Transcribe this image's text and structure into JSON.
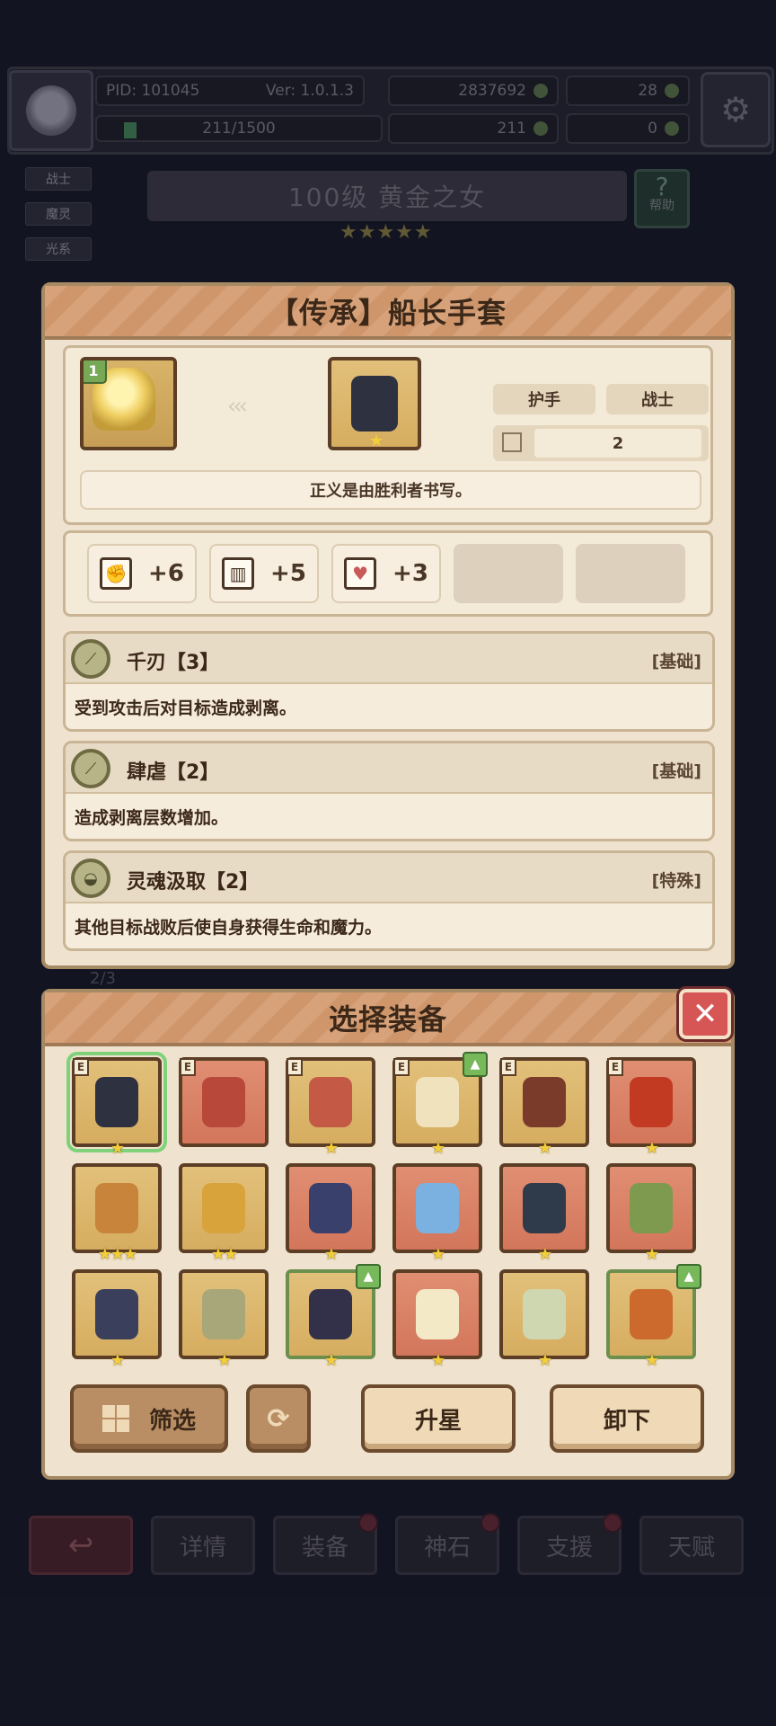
{
  "hud": {
    "pid": "PID: 101045",
    "version": "Ver: 1.0.1.3",
    "gold": "2837692",
    "gems": "28",
    "exp": "211/1500",
    "clover": "211",
    "keys": "0"
  },
  "hero": {
    "tags": [
      "战士",
      "魔灵",
      "光系"
    ],
    "title": "100级  黄金之女",
    "stars": "★★★★★",
    "help_label": "帮助"
  },
  "item_detail": {
    "title": "【传承】船长手套",
    "hero_level": "1",
    "slot": "护手",
    "class": "战士",
    "count": "2",
    "flavor": "正义是由胜利者书写。",
    "stats": [
      {
        "icon": "fist-icon",
        "value": "+6"
      },
      {
        "icon": "book-icon",
        "value": "+5"
      },
      {
        "icon": "heart-icon",
        "value": "+3"
      }
    ],
    "skills": [
      {
        "name": "千刃【3】",
        "type": "[基础]",
        "desc": "受到攻击后对目标造成剥离。"
      },
      {
        "name": "肆虐【2】",
        "type": "[基础]",
        "desc": "造成剥离层数增加。"
      },
      {
        "name": "灵魂汲取【2】",
        "type": "[特殊]",
        "desc": "其他目标战败后使自身获得生命和魔力。"
      }
    ]
  },
  "select_panel": {
    "title": "选择装备",
    "equip_badge": "E",
    "items": [
      {
        "color": "#2d3140",
        "bg": "gold",
        "equipped": true,
        "stars": "★",
        "selected": true
      },
      {
        "color": "#b8483a",
        "bg": "red",
        "equipped": true,
        "stars": ""
      },
      {
        "color": "#c45a45",
        "bg": "gold",
        "equipped": true,
        "stars": "★"
      },
      {
        "color": "#efe2bd",
        "bg": "gold",
        "equipped": true,
        "stars": "★",
        "upgrade": true
      },
      {
        "color": "#7a3b2a",
        "bg": "gold",
        "equipped": true,
        "stars": "★"
      },
      {
        "color": "#c33a22",
        "bg": "red",
        "equipped": true,
        "stars": "★"
      },
      {
        "color": "#c8843a",
        "bg": "gold",
        "stars": "★★★"
      },
      {
        "color": "#d9a33c",
        "bg": "gold",
        "stars": "★★"
      },
      {
        "color": "#39406b",
        "bg": "red",
        "stars": "★"
      },
      {
        "color": "#7bb1e0",
        "bg": "red",
        "stars": "★"
      },
      {
        "color": "#2f3a4a",
        "bg": "red",
        "stars": "★"
      },
      {
        "color": "#7e9a4e",
        "bg": "red",
        "stars": "★"
      },
      {
        "color": "#3a3f5c",
        "bg": "gold",
        "stars": "★"
      },
      {
        "color": "#a7a77a",
        "bg": "gold",
        "stars": "★"
      },
      {
        "color": "#33304a",
        "bg": "gold",
        "stars": "★",
        "upgrade": true,
        "green": true
      },
      {
        "color": "#f3e9c7",
        "bg": "red",
        "stars": "★"
      },
      {
        "color": "#cfd7b0",
        "bg": "gold",
        "stars": "★"
      },
      {
        "color": "#cc6a2e",
        "bg": "gold",
        "stars": "★",
        "upgrade": true,
        "green": true
      }
    ],
    "filter_label": "筛选",
    "star_up_label": "升星",
    "unequip_label": "卸下"
  },
  "bg_counter": "2/3",
  "nav": {
    "details": "详情",
    "equipment": "装备",
    "god_stone": "神石",
    "support": "支援",
    "talent": "天赋"
  }
}
